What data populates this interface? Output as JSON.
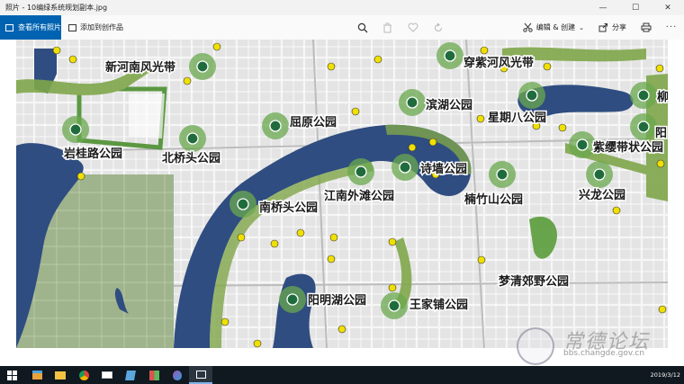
{
  "window": {
    "title": "照片 - 10编绿系统规划副本.jpg",
    "minimize": "—",
    "maximize": "☐",
    "close": "✕"
  },
  "toolbar": {
    "view_all": "查看所有照片",
    "add_to_creation": "添加到创作品",
    "edit_create": "编辑 & 创建",
    "share": "分享"
  },
  "map": {
    "labels": [
      "新河南风光带",
      "穿紫河风光带",
      "滨湖公园",
      "星期八公园",
      "岩桂路公园",
      "北桥头公园",
      "屈原公园",
      "诗墙公园",
      "紫缨带状公园",
      "江南外滩公园",
      "南桥头公园",
      "楠竹山公园",
      "兴龙公园",
      "梦清郊野公园",
      "阳明湖公园",
      "王家铺公园",
      "阳",
      "柳"
    ]
  },
  "watermark": {
    "site": "常德论坛",
    "url": "bbs.changde.gov.cn"
  },
  "taskbar": {
    "date": "2019/3/12"
  },
  "colors": {
    "water": "#2f4d80",
    "green": "#5a9c3a",
    "park_dot": "#1f6b3c",
    "yellow_dot": "#f0e000",
    "accent": "#0063b1"
  }
}
